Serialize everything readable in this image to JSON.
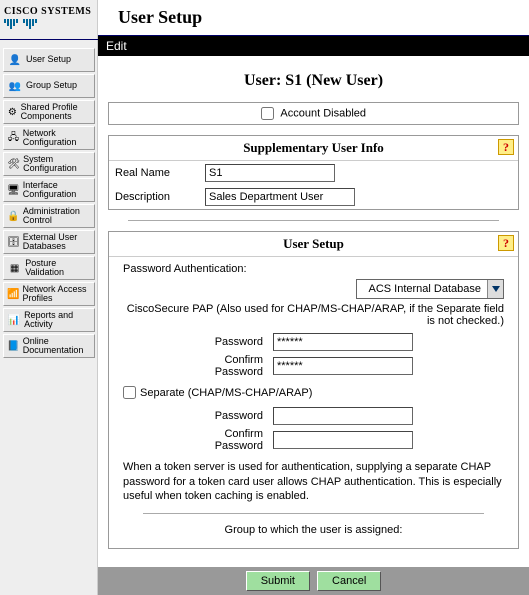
{
  "logo_text": "CISCO SYSTEMS",
  "page_title": "User Setup",
  "editbar": "Edit",
  "sidebar": {
    "items": [
      {
        "label": "User\nSetup"
      },
      {
        "label": "Group\nSetup"
      },
      {
        "label": "Shared Profile\nComponents"
      },
      {
        "label": "Network\nConfiguration"
      },
      {
        "label": "System\nConfiguration"
      },
      {
        "label": "Interface\nConfiguration"
      },
      {
        "label": "Administration\nControl"
      },
      {
        "label": "External User\nDatabases"
      },
      {
        "label": "Posture\nValidation"
      },
      {
        "label": "Network Access\nProfiles"
      },
      {
        "label": "Reports and\nActivity"
      },
      {
        "label": "Online\nDocumentation"
      }
    ]
  },
  "user_heading": "User: S1 (New User)",
  "account_disabled_label": "Account Disabled",
  "supp": {
    "header": "Supplementary User Info",
    "real_name_label": "Real Name",
    "real_name_value": "S1",
    "description_label": "Description",
    "description_value": "Sales Department User"
  },
  "setup": {
    "header": "User Setup",
    "pa_label": "Password Authentication:",
    "pa_selected": "ACS Internal Database",
    "note": "CiscoSecure PAP (Also used for CHAP/MS-CHAP/ARAP, if the Separate field is not checked.)",
    "password_label": "Password",
    "password_value": "******",
    "confirm_label": "Confirm\nPassword",
    "confirm_value": "******",
    "separate_label": "Separate (CHAP/MS-CHAP/ARAP)",
    "password2_label": "Password",
    "password2_value": "",
    "confirm2_label": "Confirm\nPassword",
    "confirm2_value": "",
    "helptext": "When a token server is used for authentication, supplying a separate CHAP password for a token card user allows CHAP authentication. This is especially useful when token caching is enabled.",
    "group_label": "Group to which the user is assigned:"
  },
  "buttons": {
    "submit": "Submit",
    "cancel": "Cancel"
  }
}
